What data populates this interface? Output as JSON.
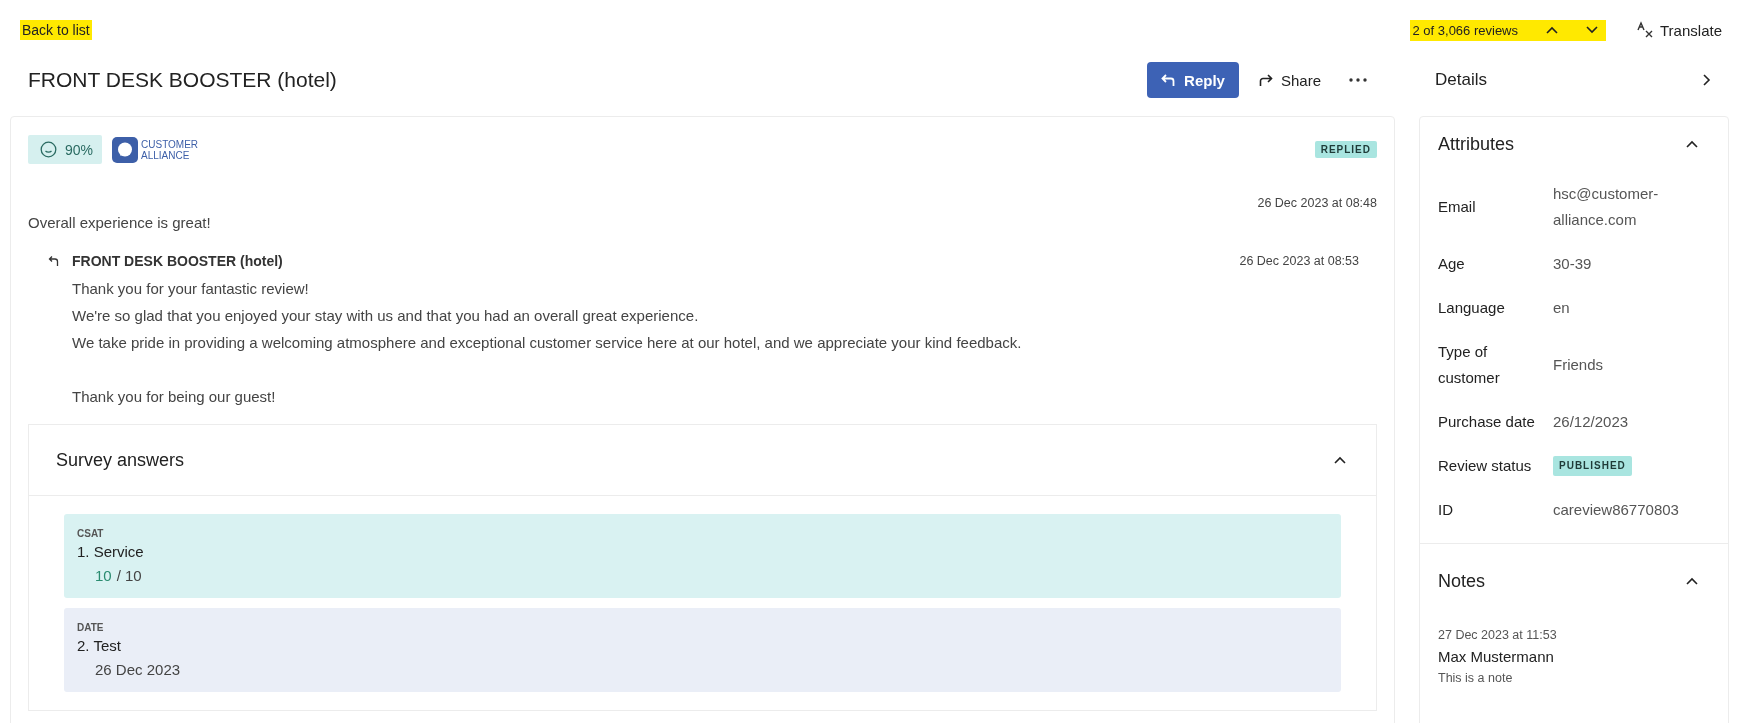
{
  "top_bar": {
    "back_link": {
      "label": "Back to list",
      "highlighted": true
    },
    "pager": {
      "label": "2 of 3,066 reviews",
      "highlighted": true
    },
    "translate": "Translate"
  },
  "header": {
    "title": "FRONT DESK BOOSTER (hotel)",
    "reply": "Reply",
    "share": "Share"
  },
  "review": {
    "score": "90%",
    "source_logo": [
      "CUSTOMER",
      "ALLIANCE"
    ],
    "status": "REPLIED",
    "date": "26 Dec 2023 at 08:48",
    "text": "Overall experience is great!",
    "reply": {
      "author": "FRONT DESK BOOSTER (hotel)",
      "date": "26 Dec 2023 at 08:53",
      "paragraphs": [
        [
          "Thank you for your fantastic review!",
          "We're so glad that you enjoyed your stay with us and that you had an overall great experience.",
          "We take pride in providing a welcoming atmosphere and exceptional customer service here at our hotel, and we appreciate your kind feedback."
        ],
        [
          "Thank you for being our guest!"
        ]
      ]
    }
  },
  "survey": {
    "title": "Survey answers",
    "expanded": true,
    "answers": [
      {
        "kind": "csat",
        "type_label": "CSAT",
        "question": "1. Service",
        "score": "10",
        "total": "/ 10"
      },
      {
        "kind": "date",
        "type_label": "DATE",
        "question": "2. Test",
        "value": "26 Dec 2023"
      }
    ]
  },
  "sidebar": {
    "details": "Details",
    "attributes": {
      "title": "Attributes",
      "expanded": true,
      "rows": [
        {
          "kind": "text",
          "label": "Email",
          "value": "hsc@customer-alliance.com"
        },
        {
          "kind": "text",
          "label": "Age",
          "value": "30-39"
        },
        {
          "kind": "text",
          "label": "Language",
          "value": "en"
        },
        {
          "kind": "text",
          "label": "Type of customer",
          "value": "Friends"
        },
        {
          "kind": "text",
          "label": "Purchase date",
          "value": "26/12/2023"
        },
        {
          "kind": "badge",
          "label": "Review status",
          "value": "PUBLISHED"
        },
        {
          "kind": "text",
          "label": "ID",
          "value": "careview86770803"
        }
      ]
    },
    "notes": {
      "title": "Notes",
      "expanded": true,
      "items": [
        {
          "date": "27 Dec 2023 at 11:53",
          "author": "Max Mustermann",
          "text": "This is a note"
        }
      ]
    }
  }
}
